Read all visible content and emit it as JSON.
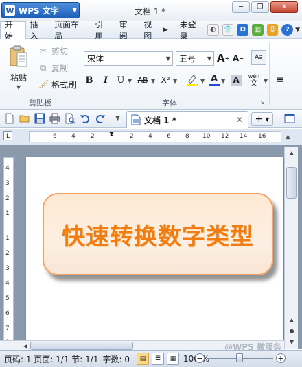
{
  "title_bar": {
    "app_label": "WPS 文字",
    "app_logo_text": "W",
    "document_title": "文档 1 *"
  },
  "menu": {
    "tabs": [
      "开始",
      "插入",
      "页面布局",
      "引用",
      "审阅",
      "视图"
    ],
    "active_tab": "开始",
    "login_label": "未登录"
  },
  "ribbon": {
    "clipboard": {
      "paste_label": "粘贴",
      "cut_label": "剪切",
      "copy_label": "复制",
      "format_painter_label": "格式刷",
      "group_label": "剪贴板"
    },
    "font": {
      "font_name": "宋体",
      "font_size": "五号",
      "group_label": "字体",
      "bold": "B",
      "italic": "I",
      "underline": "U",
      "strike": "AB",
      "superscript": "X²",
      "phonetic": "wén"
    }
  },
  "document_tab": {
    "label": "文档 1 *"
  },
  "rulers": {
    "horizontal_ticks": [
      "6",
      "4",
      "2",
      "2",
      "4",
      "6",
      "8",
      "10",
      "12",
      "14",
      "16"
    ],
    "vertical_ticks": [
      "4",
      "3",
      "2",
      "1",
      "1",
      "2",
      "3",
      "4",
      "5",
      "6",
      "7",
      "8"
    ]
  },
  "document": {
    "banner_text": "快速转换数字类型"
  },
  "watermark": "@WPS 微服务",
  "status": {
    "page_info": "页码: 1 页面: 1/1 节: 1/1",
    "word_count": "字数: 0",
    "zoom": "100 %"
  },
  "colors": {
    "banner_text": "#f07c12",
    "banner_border": "#f2a267",
    "accent_blue": "#1d5eb8"
  }
}
